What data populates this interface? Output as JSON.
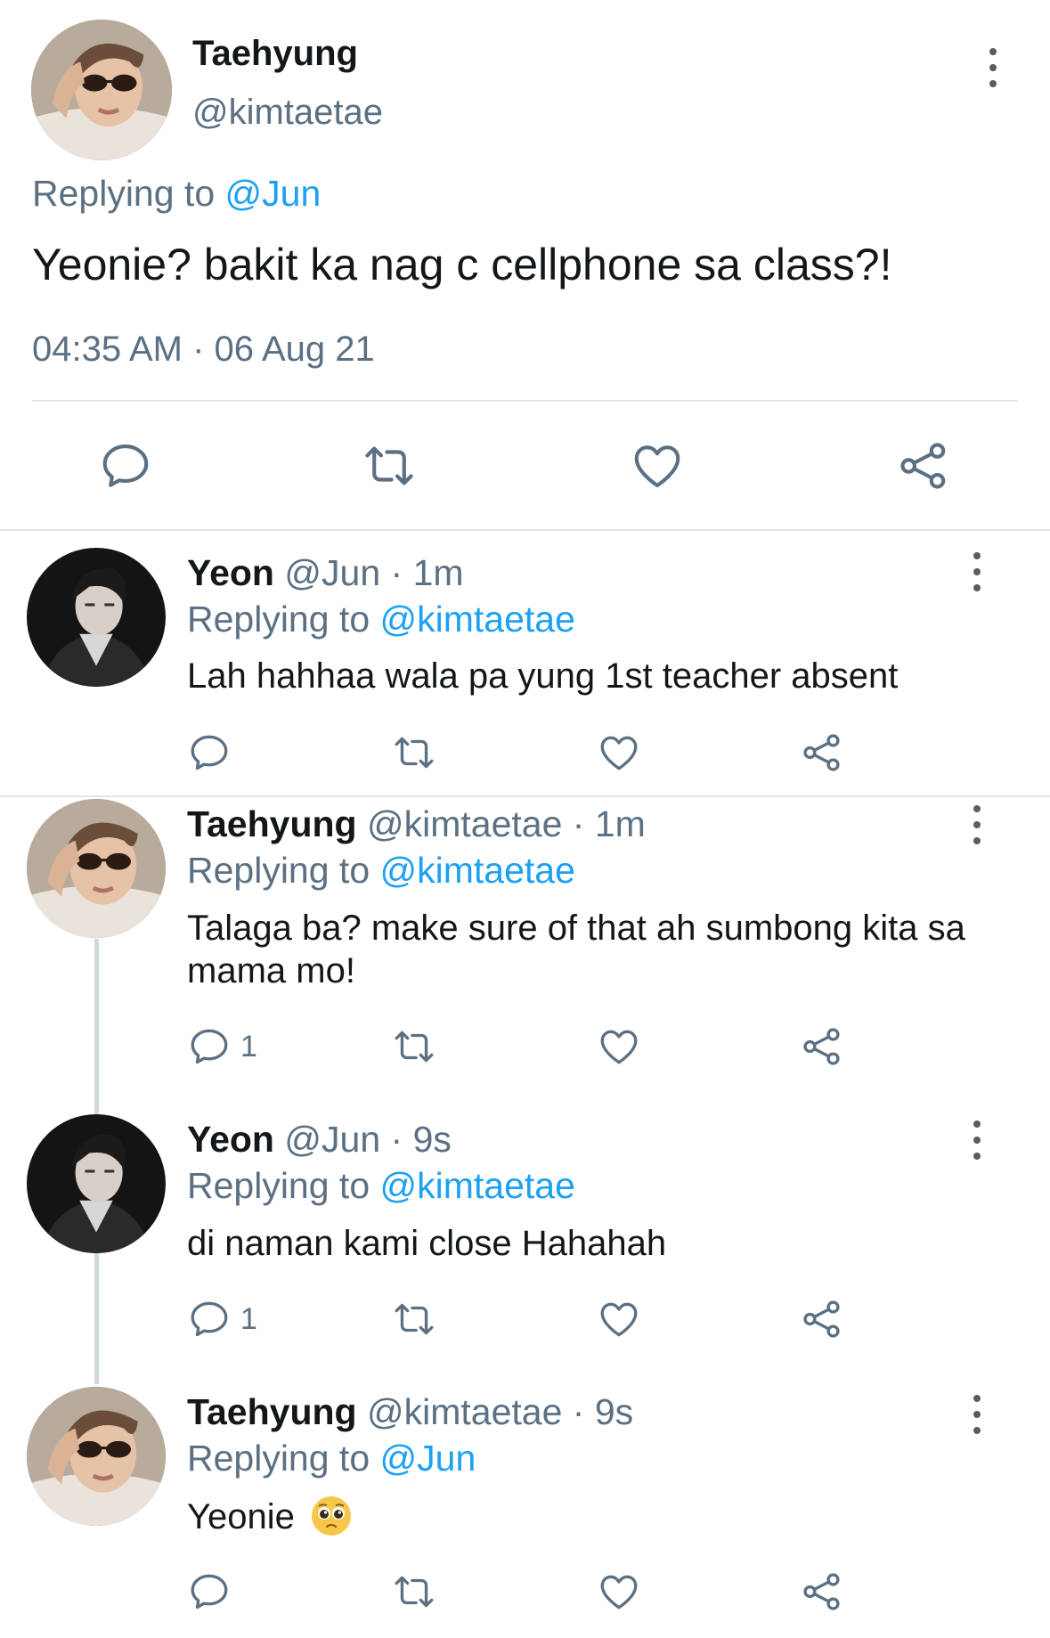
{
  "main_tweet": {
    "name": "Taehyung",
    "handle": "@kimtaetae",
    "replying_prefix": "Replying to",
    "replying_to": "@Jun",
    "text": "Yeonie? bakit ka nag c cellphone sa class?!",
    "timestamp": "04:35 AM · 06 Aug 21"
  },
  "replies": [
    {
      "name": "Yeon",
      "handle": "@Jun",
      "time": "· 1m",
      "replying_prefix": "Replying to",
      "replying_to": "@kimtaetae",
      "text": "Lah hahhaa wala pa yung 1st teacher absent",
      "reply_count": ""
    },
    {
      "name": "Taehyung",
      "handle": "@kimtaetae",
      "time": "· 1m",
      "replying_prefix": "Replying to",
      "replying_to": "@kimtaetae",
      "text": "Talaga ba? make sure of that ah sumbong kita sa mama mo!",
      "reply_count": "1"
    },
    {
      "name": "Yeon",
      "handle": "@Jun",
      "time": "· 9s",
      "replying_prefix": "Replying to",
      "replying_to": "@kimtaetae",
      "text": "di naman kami close Hahahah",
      "reply_count": "1"
    },
    {
      "name": "Taehyung",
      "handle": "@kimtaetae",
      "time": "· 9s",
      "replying_prefix": "Replying to",
      "replying_to": "@Jun",
      "text": "Yeonie",
      "emoji": "pleading-face-emoji",
      "reply_count": ""
    }
  ],
  "icons": {
    "reply": "speech-bubble-icon",
    "retweet": "retweet-icon",
    "like": "heart-icon",
    "share": "share-icon",
    "more": "vertical-dots-icon"
  },
  "colors": {
    "link": "#1da1f2",
    "secondary_text": "#5b7083",
    "icon": "#5b7083",
    "divider": "#e1e6ea"
  }
}
